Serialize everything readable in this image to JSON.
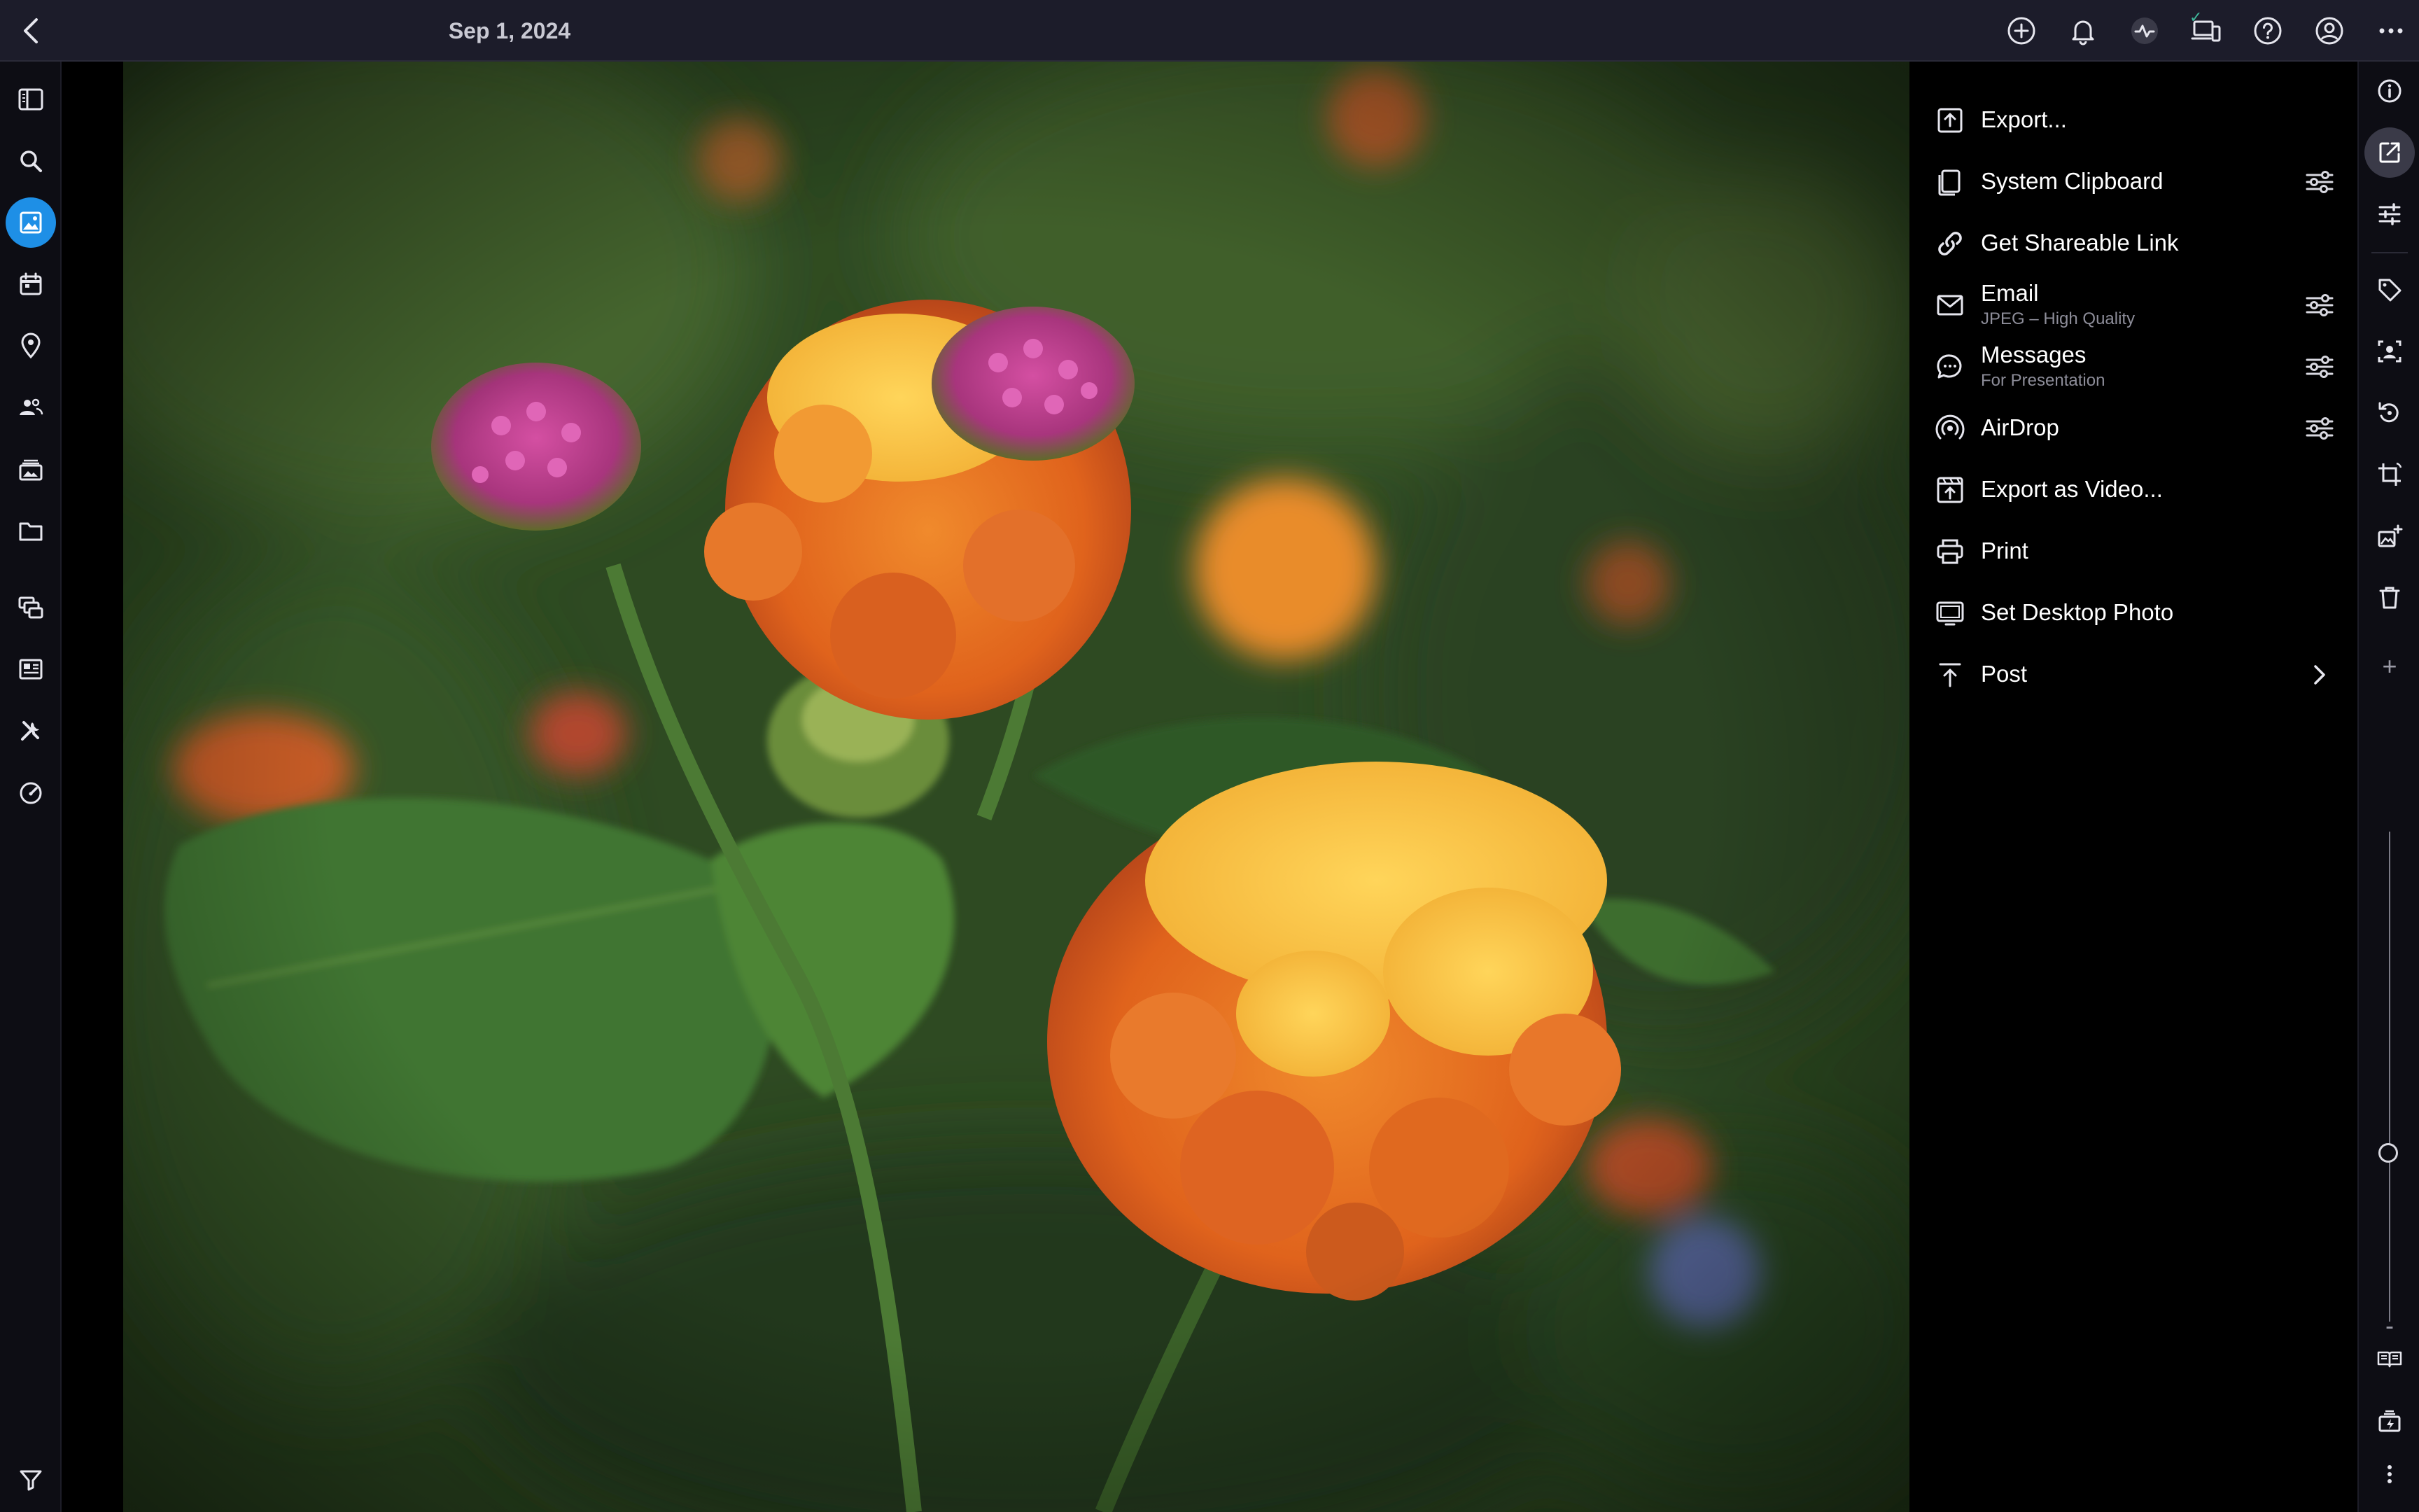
{
  "header": {
    "title": "Sep 1, 2024",
    "back_icon": "chevron-left-icon",
    "icons": [
      "add-circle-icon",
      "bell-icon",
      "activity-icon",
      "devices-icon",
      "help-icon",
      "account-icon",
      "more-horizontal-icon"
    ],
    "sync_mark": "✓"
  },
  "left_nav": {
    "items": [
      "sidebar-toggle-icon",
      "search-icon",
      "photos-icon",
      "calendar-icon",
      "places-icon",
      "people-icon",
      "albums-icon",
      "folder-icon",
      "collections-icon",
      "dashboard-icon",
      "tools-icon",
      "speed-icon",
      "filter-icon"
    ],
    "active": "photos-icon"
  },
  "share_menu": {
    "items": [
      {
        "label": "Export...",
        "icon": "export-icon"
      },
      {
        "label": "System Clipboard",
        "icon": "clipboard-icon",
        "has_settings": true
      },
      {
        "label": "Get Shareable Link",
        "icon": "link-icon"
      },
      {
        "label": "Email",
        "sublabel": "JPEG – High Quality",
        "icon": "email-icon",
        "has_settings": true
      },
      {
        "label": "Messages",
        "sublabel": "For Presentation",
        "icon": "messages-icon",
        "has_settings": true
      },
      {
        "label": "AirDrop",
        "icon": "airdrop-icon",
        "has_settings": true
      },
      {
        "label": "Export as Video...",
        "icon": "video-export-icon"
      },
      {
        "label": "Print",
        "icon": "print-icon"
      },
      {
        "label": "Set Desktop Photo",
        "icon": "desktop-photo-icon"
      },
      {
        "label": "Post",
        "icon": "post-icon",
        "has_submenu": true
      }
    ]
  },
  "right_rail": {
    "items": [
      "info-icon",
      "share-icon",
      "adjust-icon",
      "tag-icon",
      "face-icon",
      "rotate-icon",
      "crop-icon",
      "edit-plus-icon",
      "trash-icon"
    ],
    "active": "share-icon",
    "zoom_plus": "+",
    "zoom_minus": "-",
    "zoom_level": 0.35,
    "bottom_items": [
      "book-icon",
      "export-batch-icon",
      "more-vertical-icon"
    ]
  },
  "colors": {
    "accent": "#1e8fe6",
    "topbar": "#1c1c2a",
    "rail": "#0d0d14",
    "panel": "#000000"
  }
}
